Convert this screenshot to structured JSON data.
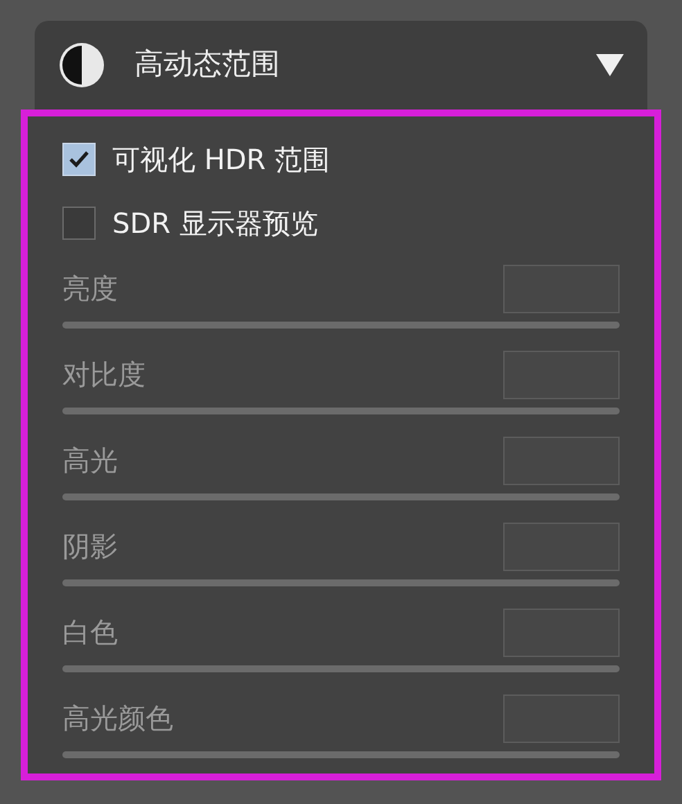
{
  "panel": {
    "title": "高动态范围",
    "expanded": true
  },
  "options": [
    {
      "label": "可视化 HDR 范围",
      "checked": true
    },
    {
      "label": "SDR 显示器预览",
      "checked": false
    }
  ],
  "sliders": [
    {
      "label": "亮度",
      "disabled": true
    },
    {
      "label": "对比度",
      "disabled": true
    },
    {
      "label": "高光",
      "disabled": true
    },
    {
      "label": "阴影",
      "disabled": true
    },
    {
      "label": "白色",
      "disabled": true
    },
    {
      "label": "高光颜色",
      "disabled": true
    }
  ]
}
